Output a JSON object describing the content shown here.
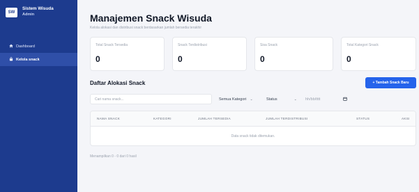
{
  "sidebar": {
    "logo": "SW",
    "title": "Sistem Wisuda",
    "subtitle": "Admin",
    "items": [
      {
        "label": "Dashboard",
        "icon": "home-icon"
      },
      {
        "label": "Kelola snack",
        "icon": "box-icon"
      }
    ]
  },
  "header": {
    "title": "Manajemen Snack Wisuda",
    "subtitle": "Kelola alokasi dan distribusi snack berdasarkan jumlah bersedia terakhir"
  },
  "cards": [
    {
      "label": "Total Snack Tersedia",
      "value": "0"
    },
    {
      "label": "Snack Terdistribusi",
      "value": "0"
    },
    {
      "label": "Sisa Snack",
      "value": "0"
    },
    {
      "label": "Total Kategori Snack",
      "value": "0"
    }
  ],
  "section": {
    "title": "Daftar Alokasi Snack",
    "add_button": "+ Tambah Snack Baru"
  },
  "filters": {
    "search_placeholder": "Cari nama snack...",
    "category": "Semua Kategori",
    "status": "Status",
    "date_placeholder": "hh/bb/tttt"
  },
  "table": {
    "columns": [
      "NAMA SNACK",
      "KATEGORI",
      "JUMLAH TERSEDIA",
      "JUMLAH TERDISTRIBUSI",
      "STATUS",
      "AKSI"
    ],
    "empty_message": "Data snack tidak ditemukan."
  },
  "footer": {
    "info": "Menampilkan 0 - 0 dari 0 hasil"
  },
  "colors": {
    "sidebar": "#1d3b8e",
    "accent": "#2563eb"
  }
}
